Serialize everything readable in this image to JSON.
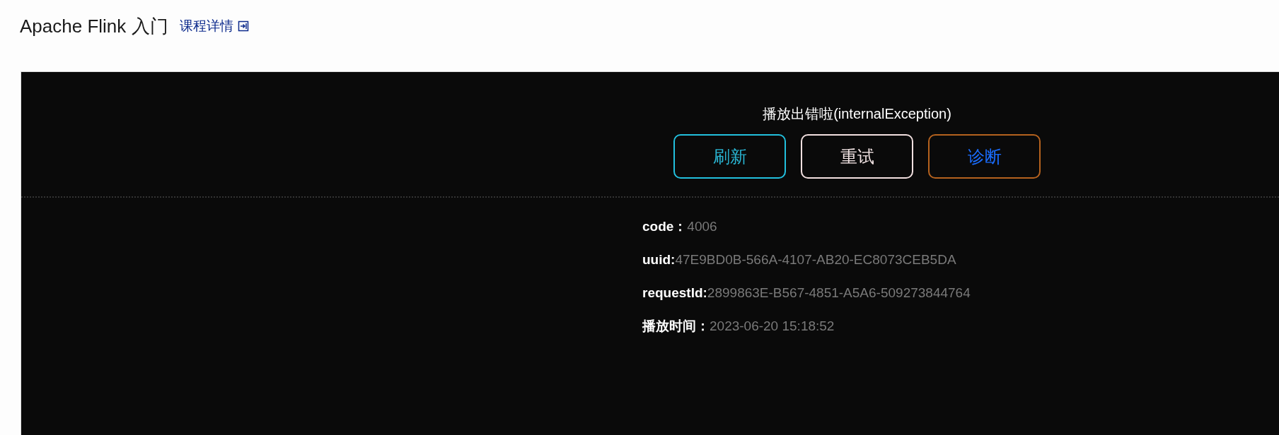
{
  "header": {
    "title": "Apache Flink 入门",
    "link": "课程详情"
  },
  "player": {
    "error_message": "播放出错啦(internalException)",
    "buttons": [
      {
        "label": "刷新",
        "kind": "refresh",
        "color": "#22c0de"
      },
      {
        "label": "重试",
        "kind": "retry",
        "color": "#f2e0e0"
      },
      {
        "label": "诊断",
        "kind": "diagnose",
        "color": "#b5621e"
      }
    ],
    "details": [
      {
        "label": "code：",
        "value": "4006"
      },
      {
        "label": "uuid:",
        "value": "47E9BD0B-566A-4107-AB20-EC8073CEB5DA"
      },
      {
        "label": "requestId:",
        "value": "2899863E-B567-4851-A5A6-509273844764"
      },
      {
        "label": "播放时间：",
        "value": "2023-06-20 15:18:52"
      }
    ]
  }
}
